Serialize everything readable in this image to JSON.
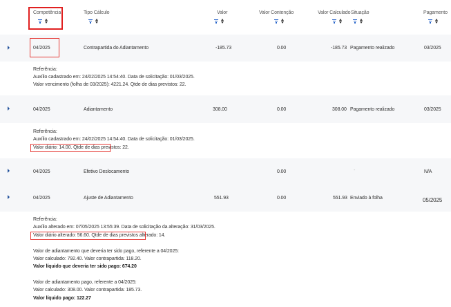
{
  "header": {
    "competencia": "Competência",
    "tipo_calculo": "Tipo Cálculo",
    "valor": "Valor",
    "valor_contencao": "Valor Contenção",
    "valor_calculado": "Valor Calculado",
    "situacao": "Situação",
    "pagamento": "Pagamento"
  },
  "rows": [
    {
      "competencia": "04/2025",
      "tipo": "Contrapartida do Adiantamento",
      "valor": "-185.73",
      "contencao": "0.00",
      "calculado": "-185.73",
      "situacao": "Pagamento realizado",
      "pagamento": "03/2025",
      "detail": {
        "title": "Referência:",
        "line1": "Auxílio cadastrado em: 24/02/2025 14:54:40. Data de solicitação: 01/03/2025.",
        "line2": "Valor vencimento (folha de 03/2025): 4221.24. Qtde de dias previstos: 22."
      }
    },
    {
      "competencia": "04/2025",
      "tipo": "Adiantamento",
      "valor": "308.00",
      "contencao": "0.00",
      "calculado": "308.00",
      "situacao": "Pagamento realizado",
      "pagamento": "03/2025",
      "detail": {
        "title": "Referência:",
        "line1": "Auxílio cadastrado em: 24/02/2025 14:54:40. Data de solicitação: 01/03/2025.",
        "line2": "Valor diário: 14.00. Qtde de dias previstos: 22."
      }
    },
    {
      "competencia": "04/2025",
      "tipo": "Efetivo Deslocamento",
      "valor": "",
      "contencao": "0.00",
      "calculado": "",
      "situacao": "-",
      "pagamento": "N/A"
    },
    {
      "competencia": "04/2025",
      "tipo": "Ajuste de Adiantamento",
      "valor": "551.93",
      "contencao": "0.00",
      "calculado": "551.93",
      "situacao": "Enviado à folha",
      "pagamento": "05/2025",
      "detail": {
        "title": "Referência:",
        "line1": "Auxílio alterado em: 07/05/2025 13:55:39. Data de solicitação da alteração: 31/03/2025.",
        "line2": "Valor diário alterado: 56.60. Qtde de dias previstos alterado: 14.",
        "line3": "Valor de adiantamento que deveria ter sido pago, referente a 04/2025:",
        "line4": "Valor calculado: 792.40. Valor contrapartida: 118.20.",
        "line5": "Valor líquido que deveria ter sido pago: 674.20",
        "line6": "Valor de adiantamento pago, referente a 04/2025:",
        "line7": "Valor calculado: 308.00. Valor contrapartida: 185.73.",
        "line8": "Valor líquido pago: 122.27"
      }
    }
  ]
}
